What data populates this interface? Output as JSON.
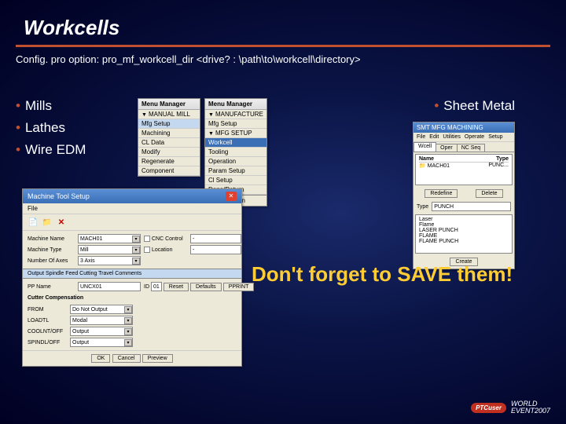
{
  "title": "Workcells",
  "config_line": "Config. pro option: pro_mf_workcell_dir <drive? : \\path\\to\\workcell\\directory>",
  "left_bullets": [
    "Mills",
    "Lathes",
    "Wire EDM"
  ],
  "right_bullets": [
    "Sheet Metal"
  ],
  "callout": "Don't forget to SAVE them!",
  "menu_manager_1": {
    "title": "Menu Manager",
    "section": "MANUAL MILL",
    "items": [
      "Mfg Setup",
      "Machining",
      "CL Data",
      "Modify",
      "Regenerate",
      "Component"
    ]
  },
  "menu_manager_2": {
    "title": "Menu Manager",
    "section1": "MANUFACTURE",
    "item1": "Mfg Setup",
    "section2": "MFG SETUP",
    "items": [
      "Workcell",
      "Tooling",
      "Operation",
      "Param Setup",
      "Cl Setup",
      "Done/Return"
    ],
    "return": "Return"
  },
  "mts": {
    "title": "Machine Tool Setup",
    "menu": "File",
    "toolbar": {
      "new_icon": "📄",
      "open_icon": "📁",
      "delete_icon": "✕"
    },
    "fields": {
      "machine_name_label": "Machine Name",
      "machine_name_value": "MACH01",
      "cnc_control_label": "CNC Control",
      "cnc_control_value": "-",
      "machine_type_label": "Machine Type",
      "machine_type_value": "Mill",
      "location_label": "Location",
      "location_value": "-",
      "num_axes_label": "Number Of Axes",
      "num_axes_value": "3 Axis"
    },
    "output_header": "Output   Spindle   Feed   Cutting   Travel   Comments",
    "out_row1": {
      "pp_name_label": "PP Name",
      "pp_name_value": "UNCX01",
      "id_label": "ID",
      "id_value": "01",
      "reset_btn": "Reset",
      "defaults_btn": "Defaults",
      "pprint_btn": "PPRINT"
    },
    "from_label": "FROM",
    "from_value": "Do Not Output",
    "params": {
      "ltr_label": "LOADTL",
      "ltr_value": "Modal",
      "coolnt_label": "COOLNT/OFF",
      "coolnt_value": "Output",
      "spindl_label": "SPINDL/OFF",
      "spindl_value": "Output"
    },
    "cutter_compensation": "Cutter Compensation",
    "buttons": {
      "ok": "OK",
      "cancel": "Cancel",
      "preview": "Preview"
    }
  },
  "smt": {
    "title": "SMT MFG MACHINING",
    "menu_items": [
      "File",
      "Edit",
      "Utilities",
      "Operate",
      "Setup"
    ],
    "tabs": [
      "Wcell",
      "Oper",
      "NC Seq"
    ],
    "tree_header_name": "Name",
    "tree_header_type": "Type",
    "tree_item": "MACH01",
    "tree_item_type": "PUNC...",
    "mid_buttons": {
      "redefine": "Redefine",
      "delete": "Delete"
    },
    "type_label": "Type",
    "type_value": "PUNCH",
    "type_items": [
      "Laser",
      "Flame",
      "LASER PUNCH",
      "FLAME",
      "FLAME PUNCH"
    ],
    "create_btn": "Create"
  },
  "footer": {
    "ptc": "PTCuser",
    "event_line1": "WORLD",
    "event_line2": "EVENT2007"
  }
}
